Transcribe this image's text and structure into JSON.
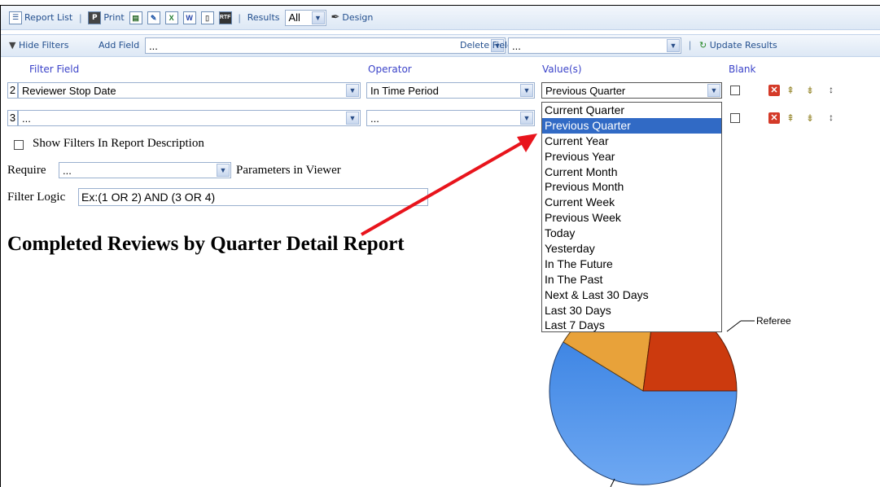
{
  "toolbar": {
    "report_list": "Report List",
    "print": "Print",
    "results_label": "Results",
    "results_value": "All",
    "design": "Design",
    "icons": [
      "excel-icon",
      "word-icon",
      "pdf-icon",
      "rtf-icon",
      "csv-icon",
      "xml-icon"
    ]
  },
  "filters_bar": {
    "hide_filters": "Hide Filters",
    "add_field": "Add Field",
    "add_field_value": "...",
    "delete_field": "Delete Field",
    "delete_field_value": "...",
    "update_results": "Update Results"
  },
  "filter_headers": {
    "field": "Filter Field",
    "operator": "Operator",
    "values": "Value(s)",
    "blank": "Blank"
  },
  "filter_rows": [
    {
      "index": "2",
      "field": "Reviewer Stop Date",
      "operator": "In Time Period",
      "value": "Previous Quarter"
    },
    {
      "index": "3",
      "field": "...",
      "operator": "...",
      "value": ""
    }
  ],
  "options": {
    "show_filters_label": "Show Filters In Report Description",
    "require_label": "Require",
    "require_value": "...",
    "params_label": "Parameters in Viewer",
    "filter_logic_label": "Filter Logic",
    "filter_logic_value": "Ex:(1 OR 2) AND (3 OR 4)"
  },
  "report": {
    "title": "Completed Reviews by Quarter Detail Report",
    "pie_label": "Referee"
  },
  "dropdown": {
    "selected": "Previous Quarter",
    "items": [
      "Current Quarter",
      "Previous Quarter",
      "Current Year",
      "Previous Year",
      "Current Month",
      "Previous Month",
      "Current Week",
      "Previous Week",
      "Today",
      "Yesterday",
      "In The Future",
      "In The Past",
      "Next & Last 30 Days",
      "Last 30 Days",
      "Last 7 Days"
    ]
  },
  "colors": {
    "pie_blue": "#3f86e4",
    "pie_orange": "#e8a23a",
    "pie_red": "#cc3a0e",
    "arrow": "#e8141c",
    "highlight": "#316ac5"
  }
}
